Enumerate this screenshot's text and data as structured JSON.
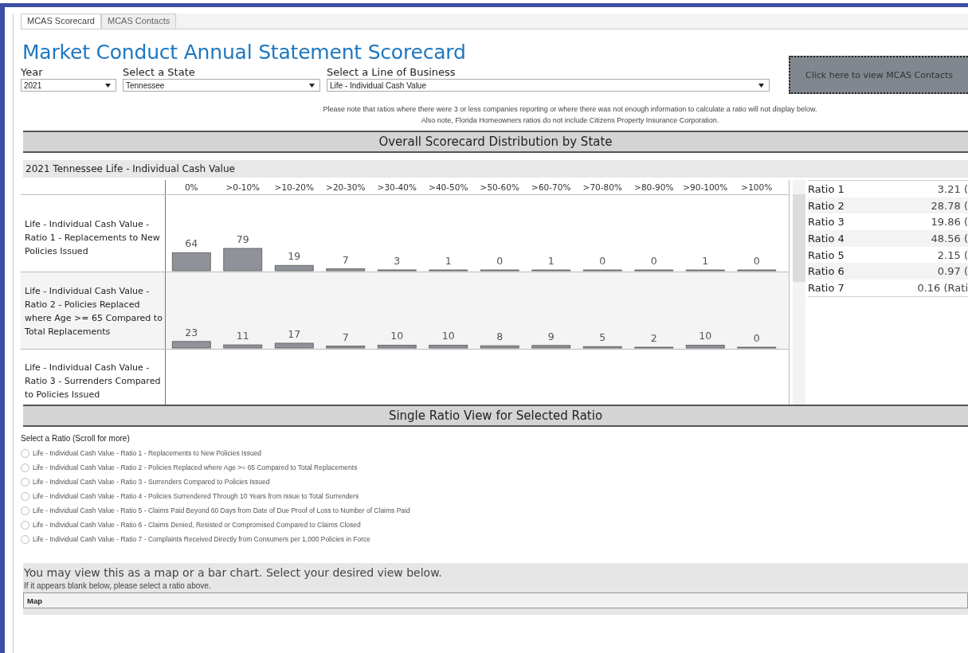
{
  "tabs": [
    {
      "label": "MCAS Scorecard",
      "selected": true
    },
    {
      "label": "MCAS Contacts",
      "selected": false
    }
  ],
  "title": "Market Conduct Annual Statement Scorecard",
  "filters": [
    {
      "label": "Year",
      "value": "2021"
    },
    {
      "label": "Select a State",
      "value": "Tennessee"
    },
    {
      "label": "Select a Line of Business",
      "value": "Life - Individual Cash Value"
    }
  ],
  "contacts_button": "Click here to view MCAS Contacts",
  "notes": [
    "Please note that ratios where there were 3 or less companies reporting or where there was not enough information to calculate a ratio will not display below.",
    "Also note, Florida Homeowners ratios do not include Citizens Property Insurance Corporation."
  ],
  "distribution": {
    "header": "Overall Scorecard Distribution by State",
    "subtitle": "2021 Tennessee Life - Individual Cash Value",
    "columns": [
      "0%",
      ">0-10%",
      ">10-20%",
      ">20-30%",
      ">30-40%",
      ">40-50%",
      ">50-60%",
      ">60-70%",
      ">70-80%",
      ">80-90%",
      ">90-100%",
      ">100%"
    ],
    "rows": [
      {
        "label": "Life - Individual Cash Value - Ratio 1 - Replacements to New Policies Issued",
        "counts": [
          "64",
          "79",
          "19",
          "7",
          "3",
          "1",
          "0",
          "1",
          "0",
          "0",
          "1",
          "0"
        ]
      },
      {
        "label": "Life - Individual Cash Value - Ratio 2 - Policies Replaced where Age >= 65 Compared to Total Replacements",
        "counts": [
          "23",
          "11",
          "17",
          "7",
          "10",
          "10",
          "8",
          "9",
          "5",
          "2",
          "10",
          "0"
        ]
      },
      {
        "label": "Life - Individual Cash Value - Ratio 3 - Surrenders Compared to Policies Issued"
      }
    ],
    "ratios": [
      {
        "name": "Ratio 1",
        "value": "3.21 ("
      },
      {
        "name": "Ratio 2",
        "value": "28.78 ("
      },
      {
        "name": "Ratio 3",
        "value": "19.86 ("
      },
      {
        "name": "Ratio 4",
        "value": "48.56 ("
      },
      {
        "name": "Ratio 5",
        "value": "2.15 ("
      },
      {
        "name": "Ratio 6",
        "value": "0.97 ("
      },
      {
        "name": "Ratio 7",
        "value": "0.16 (Rati"
      }
    ]
  },
  "single": {
    "header": "Single Ratio View for Selected Ratio",
    "prompt": "Select a Ratio (Scroll for more)",
    "options": [
      {
        "label": "Life - Individual Cash Value - Ratio 1 - Replacements to New Policies Issued",
        "selected": false
      },
      {
        "label": "Life - Individual Cash Value - Ratio 2 - Policies Replaced where Age >= 65 Compared to Total Replacements",
        "selected": false
      },
      {
        "label": "Life - Individual Cash Value - Ratio 3 - Surrenders Compared to Policies Issued",
        "selected": false
      },
      {
        "label": "Life - Individual Cash Value - Ratio 4 - Policies Surrendered Through 10 Years from Issue to Total Surrenders",
        "selected": false
      },
      {
        "label": "Life - Individual Cash Value - Ratio 5 - Claims Paid Beyond 60 Days from Date of Due Proof of Loss to Number of Claims Paid",
        "selected": false
      },
      {
        "label": "Life - Individual Cash Value - Ratio 6 - Claims Denied, Resisted or Compromised Compared to Claims Closed",
        "selected": false
      },
      {
        "label": "Life - Individual Cash Value - Ratio 7 - Complaints Received Directly from Consumers per 1,000 Policies in Force",
        "selected": false
      }
    ],
    "view_heading": "You may view this as a map or a bar chart.  Select your desired view below.",
    "view_hint": "If it appears blank below, please select a ratio above.",
    "view_value": "Map"
  }
}
